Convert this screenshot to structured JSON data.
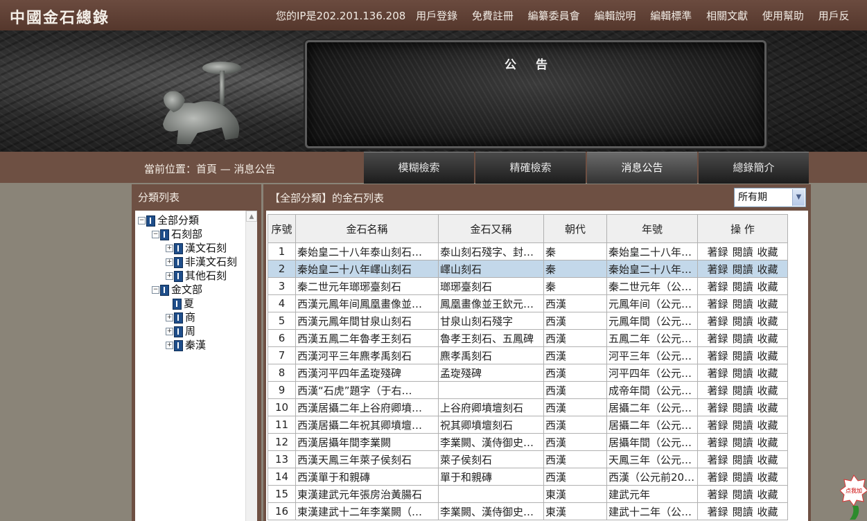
{
  "header": {
    "logo": "中國金石總錄",
    "nav": {
      "ip": "您的IP是202.201.136.208",
      "items": [
        "用戶登錄",
        "免費註冊",
        "編纂委員會",
        "編輯說明",
        "編輯標準",
        "相關文獻",
        "使用幫助",
        "用戶反"
      ]
    }
  },
  "banner": {
    "board_title": "公告"
  },
  "crumbbar": {
    "breadcrumb": "當前位置：首頁 — 消息公告",
    "tabs": [
      "模糊檢索",
      "精確檢索",
      "消息公告",
      "總錄簡介"
    ],
    "active_tab": 2
  },
  "left": {
    "title": "分類列表",
    "tree": [
      {
        "label": "全部分類",
        "level": 0,
        "toggle": "-"
      },
      {
        "label": "石刻部",
        "level": 1,
        "toggle": "-"
      },
      {
        "label": "漢文石刻",
        "level": 2,
        "toggle": "+"
      },
      {
        "label": "非漢文石刻",
        "level": 2,
        "toggle": "+"
      },
      {
        "label": "其他石刻",
        "level": 2,
        "toggle": "+"
      },
      {
        "label": "金文部",
        "level": 1,
        "toggle": "-"
      },
      {
        "label": "夏",
        "level": 2,
        "toggle": ""
      },
      {
        "label": "商",
        "level": 2,
        "toggle": "+"
      },
      {
        "label": "周",
        "level": 2,
        "toggle": "+"
      },
      {
        "label": "秦漢",
        "level": 2,
        "toggle": "+"
      }
    ]
  },
  "right": {
    "title": "【全部分類】的金石列表",
    "select_value": "所有期",
    "headers": [
      "序號",
      "金石名稱",
      "金石又稱",
      "朝代",
      "年號",
      "操 作"
    ],
    "actions": [
      "著録",
      "閱讀",
      "收藏"
    ],
    "selected_row": 1,
    "rows": [
      [
        "1",
        "秦始皇二十八年泰山刻石…",
        "泰山刻石殘字、封…",
        "秦",
        "秦始皇二十八年…"
      ],
      [
        "2",
        "秦始皇二十八年嶧山刻石",
        "嶧山刻石",
        "秦",
        "秦始皇二十八年…"
      ],
      [
        "3",
        "秦二世元年瑯琊臺刻石",
        "瑯琊臺刻石",
        "秦",
        "秦二世元年（公…"
      ],
      [
        "4",
        "西漢元鳳年间鳳凰畫像並…",
        "鳳凰畫像並王欽元…",
        "西漢",
        "元鳳年间（公元…"
      ],
      [
        "5",
        "西漢元鳳年間甘泉山刻石",
        "甘泉山刻石殘字",
        "西漢",
        "元鳳年間（公元…"
      ],
      [
        "6",
        "西漢五鳳二年魯孝王刻石",
        "魯孝王刻石、五鳳碑",
        "西漢",
        "五鳳二年（公元…"
      ],
      [
        "7",
        "西漢河平三年麃孝禹刻石",
        "麃孝禹刻石",
        "西漢",
        "河平三年（公元…"
      ],
      [
        "8",
        "西漢河平四年孟琁殘碑",
        "孟琁殘碑",
        "西漢",
        "河平四年（公元…"
      ],
      [
        "9",
        "西漢“石虎”題字（于右…",
        "",
        "西漢",
        "成帝年間（公元…"
      ],
      [
        "10",
        "西漢居攝二年上谷府卿墳…",
        "上谷府卿墳壇刻石",
        "西漢",
        "居攝二年（公元…"
      ],
      [
        "11",
        "西漢居攝二年祝其卿墳壇…",
        "祝其卿墳壇刻石",
        "西漢",
        "居攝二年（公元…"
      ],
      [
        "12",
        "西漢居攝年間李業闕",
        "李業闕、漢侍御史…",
        "西漢",
        "居攝年間（公元…"
      ],
      [
        "13",
        "西漢天鳳三年萊子侯刻石",
        "萊子侯刻石",
        "西漢",
        "天鳳三年（公元…"
      ],
      [
        "14",
        "西漢單于和親磚",
        "單于和親磚",
        "西漢",
        "西漢（公元前20…"
      ],
      [
        "15",
        "東漢建武元年張房治黃腸石",
        "",
        "東漢",
        "建武元年"
      ],
      [
        "16",
        "東漢建武十二年李業闕（…",
        "李業闕、漢侍御史…",
        "東漢",
        "建武十二年（公…"
      ]
    ]
  },
  "badge": {
    "text": "点我加"
  }
}
